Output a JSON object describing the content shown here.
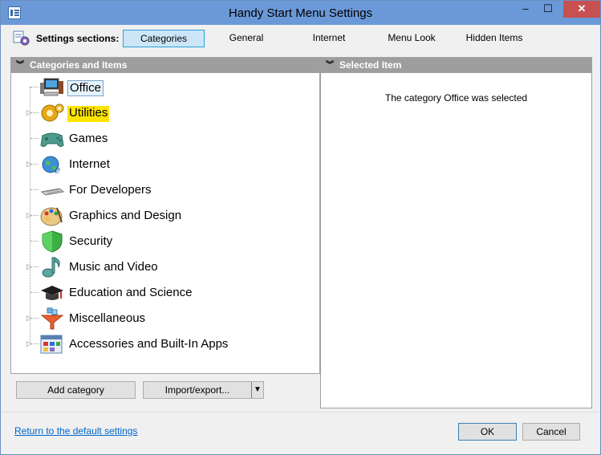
{
  "window": {
    "title": "Handy Start Menu Settings",
    "minimize": "–",
    "maximize": "☐",
    "close": "✕"
  },
  "toolbar": {
    "label": "Settings sections:",
    "tabs": [
      {
        "label": "Categories",
        "active": true
      },
      {
        "label": "General"
      },
      {
        "label": "Internet"
      },
      {
        "label": "Menu Look"
      },
      {
        "label": "Hidden Items"
      }
    ]
  },
  "left_panel": {
    "header": "Categories and Items",
    "items": [
      {
        "label": "Office",
        "icon": "office-computer-icon",
        "expandable": false,
        "state": "focused"
      },
      {
        "label": "Utilities",
        "icon": "gear-icon",
        "expandable": true,
        "state": "highlighted"
      },
      {
        "label": "Games",
        "icon": "gamepad-icon",
        "expandable": false
      },
      {
        "label": "Internet",
        "icon": "internet-globe-icon",
        "expandable": true
      },
      {
        "label": "For Developers",
        "icon": "keyboard-icon",
        "expandable": false
      },
      {
        "label": "Graphics and Design",
        "icon": "paint-palette-icon",
        "expandable": true
      },
      {
        "label": "Security",
        "icon": "shield-icon",
        "expandable": false
      },
      {
        "label": "Music and Video",
        "icon": "music-note-icon",
        "expandable": true
      },
      {
        "label": "Education and Science",
        "icon": "graduation-cap-icon",
        "expandable": false
      },
      {
        "label": "Miscellaneous",
        "icon": "funnel-icon",
        "expandable": true
      },
      {
        "label": "Accessories and Built-In Apps",
        "icon": "apps-window-icon",
        "expandable": true
      }
    ],
    "add_button": "Add category",
    "import_button": "Import/export...",
    "import_arrow": "▼"
  },
  "right_panel": {
    "header": "Selected Item",
    "message": "The category Office was selected"
  },
  "footer": {
    "reset_link": "Return to the default settings",
    "ok": "OK",
    "cancel": "Cancel"
  },
  "colors": {
    "titlebar": "#6b99d8",
    "close_button": "#c75050",
    "active_tab": "#cde6f7",
    "panel_header": "#9e9e9e",
    "highlight": "#ffe400",
    "link": "#0066cc"
  }
}
